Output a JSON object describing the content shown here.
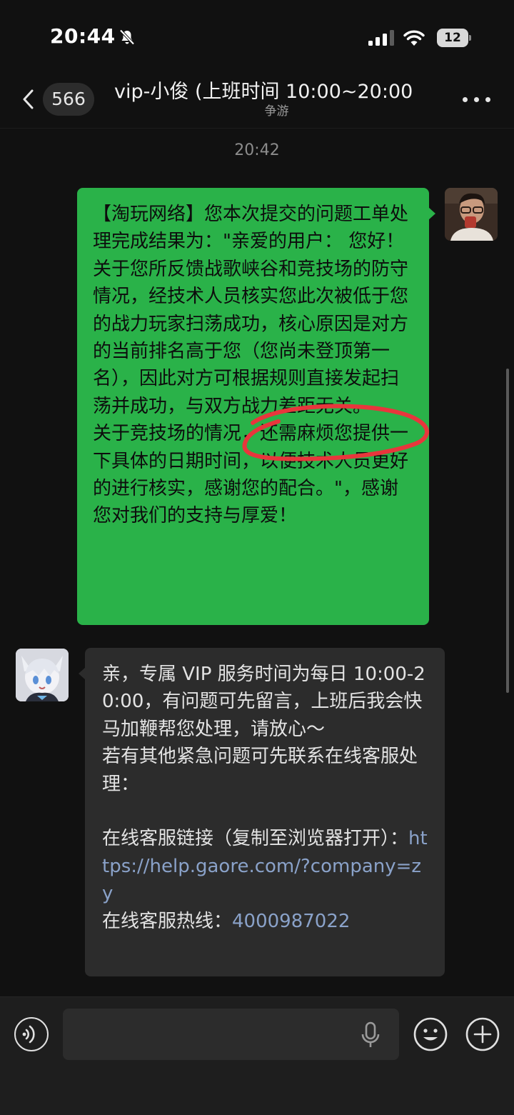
{
  "status_bar": {
    "time": "20:44",
    "battery_level": "12",
    "icons": [
      "bell-slash-icon",
      "cellular-signal-icon",
      "wifi-icon",
      "battery-icon"
    ]
  },
  "header": {
    "unread_count": "566",
    "title": "vip-小俊 (上班时间 10:00~20:00",
    "subtitle": "争游",
    "icons": [
      "chevron-left-icon",
      "more-dots-icon"
    ]
  },
  "chat": {
    "timestamp": "20:42",
    "messages": [
      {
        "sender": "me",
        "text": "【淘玩网络】您本次提交的问题工单处理完成结果为：\"亲爱的用户： 您好！\n关于您所反馈战歌峡谷和竞技场的防守情况，经技术人员核实您此次被低于您的战力玩家扫荡成功，核心原因是对方的当前排名高于您（您尚未登顶第一名），因此对方可根据规则直接发起扫荡并成功，与双方战力差距无关。\n关于竞技场的情况，还需麻烦您提供一下具体的日期时间，以便技术人员更好的进行核实，感谢您的配合。\"，感谢您对我们的支持与厚爱！"
      },
      {
        "sender": "agent",
        "text_intro": "亲，专属 VIP 服务时间为每日 10:00-20:00，有问题可先留言，上班后我会快马加鞭帮您处理，请放心～\n若有其他紧急问题可先联系在线客服处理：\n\n在线客服链接（复制至浏览器打开）：",
        "link": "https://help.gaore.com/?company=zy",
        "hotline_label": "\n在线客服热线：",
        "hotline": "4000987022"
      }
    ]
  },
  "input_bar": {
    "placeholder": "",
    "icons": [
      "voice-icon",
      "microphone-icon",
      "emoji-icon",
      "plus-icon"
    ]
  },
  "colors": {
    "background": "#111111",
    "my_bubble": "#2ab249",
    "agent_bubble": "#2c2c2c",
    "link": "#8aa2c9",
    "annotation_red": "#e8363c"
  }
}
